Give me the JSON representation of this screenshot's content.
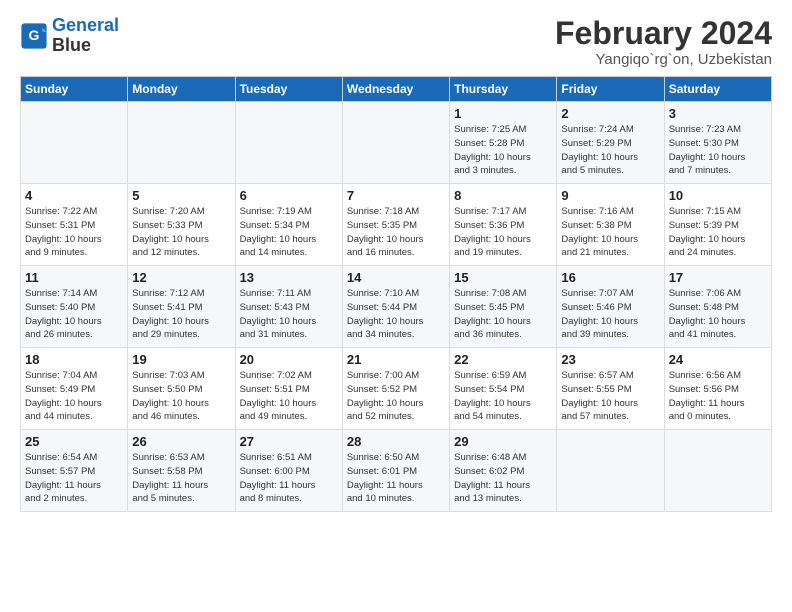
{
  "logo": {
    "line1": "General",
    "line2": "Blue"
  },
  "title": "February 2024",
  "location": "Yangiqo`rg`on, Uzbekistan",
  "days_of_week": [
    "Sunday",
    "Monday",
    "Tuesday",
    "Wednesday",
    "Thursday",
    "Friday",
    "Saturday"
  ],
  "weeks": [
    [
      {
        "day": "",
        "info": ""
      },
      {
        "day": "",
        "info": ""
      },
      {
        "day": "",
        "info": ""
      },
      {
        "day": "",
        "info": ""
      },
      {
        "day": "1",
        "info": "Sunrise: 7:25 AM\nSunset: 5:28 PM\nDaylight: 10 hours\nand 3 minutes."
      },
      {
        "day": "2",
        "info": "Sunrise: 7:24 AM\nSunset: 5:29 PM\nDaylight: 10 hours\nand 5 minutes."
      },
      {
        "day": "3",
        "info": "Sunrise: 7:23 AM\nSunset: 5:30 PM\nDaylight: 10 hours\nand 7 minutes."
      }
    ],
    [
      {
        "day": "4",
        "info": "Sunrise: 7:22 AM\nSunset: 5:31 PM\nDaylight: 10 hours\nand 9 minutes."
      },
      {
        "day": "5",
        "info": "Sunrise: 7:20 AM\nSunset: 5:33 PM\nDaylight: 10 hours\nand 12 minutes."
      },
      {
        "day": "6",
        "info": "Sunrise: 7:19 AM\nSunset: 5:34 PM\nDaylight: 10 hours\nand 14 minutes."
      },
      {
        "day": "7",
        "info": "Sunrise: 7:18 AM\nSunset: 5:35 PM\nDaylight: 10 hours\nand 16 minutes."
      },
      {
        "day": "8",
        "info": "Sunrise: 7:17 AM\nSunset: 5:36 PM\nDaylight: 10 hours\nand 19 minutes."
      },
      {
        "day": "9",
        "info": "Sunrise: 7:16 AM\nSunset: 5:38 PM\nDaylight: 10 hours\nand 21 minutes."
      },
      {
        "day": "10",
        "info": "Sunrise: 7:15 AM\nSunset: 5:39 PM\nDaylight: 10 hours\nand 24 minutes."
      }
    ],
    [
      {
        "day": "11",
        "info": "Sunrise: 7:14 AM\nSunset: 5:40 PM\nDaylight: 10 hours\nand 26 minutes."
      },
      {
        "day": "12",
        "info": "Sunrise: 7:12 AM\nSunset: 5:41 PM\nDaylight: 10 hours\nand 29 minutes."
      },
      {
        "day": "13",
        "info": "Sunrise: 7:11 AM\nSunset: 5:43 PM\nDaylight: 10 hours\nand 31 minutes."
      },
      {
        "day": "14",
        "info": "Sunrise: 7:10 AM\nSunset: 5:44 PM\nDaylight: 10 hours\nand 34 minutes."
      },
      {
        "day": "15",
        "info": "Sunrise: 7:08 AM\nSunset: 5:45 PM\nDaylight: 10 hours\nand 36 minutes."
      },
      {
        "day": "16",
        "info": "Sunrise: 7:07 AM\nSunset: 5:46 PM\nDaylight: 10 hours\nand 39 minutes."
      },
      {
        "day": "17",
        "info": "Sunrise: 7:06 AM\nSunset: 5:48 PM\nDaylight: 10 hours\nand 41 minutes."
      }
    ],
    [
      {
        "day": "18",
        "info": "Sunrise: 7:04 AM\nSunset: 5:49 PM\nDaylight: 10 hours\nand 44 minutes."
      },
      {
        "day": "19",
        "info": "Sunrise: 7:03 AM\nSunset: 5:50 PM\nDaylight: 10 hours\nand 46 minutes."
      },
      {
        "day": "20",
        "info": "Sunrise: 7:02 AM\nSunset: 5:51 PM\nDaylight: 10 hours\nand 49 minutes."
      },
      {
        "day": "21",
        "info": "Sunrise: 7:00 AM\nSunset: 5:52 PM\nDaylight: 10 hours\nand 52 minutes."
      },
      {
        "day": "22",
        "info": "Sunrise: 6:59 AM\nSunset: 5:54 PM\nDaylight: 10 hours\nand 54 minutes."
      },
      {
        "day": "23",
        "info": "Sunrise: 6:57 AM\nSunset: 5:55 PM\nDaylight: 10 hours\nand 57 minutes."
      },
      {
        "day": "24",
        "info": "Sunrise: 6:56 AM\nSunset: 5:56 PM\nDaylight: 11 hours\nand 0 minutes."
      }
    ],
    [
      {
        "day": "25",
        "info": "Sunrise: 6:54 AM\nSunset: 5:57 PM\nDaylight: 11 hours\nand 2 minutes."
      },
      {
        "day": "26",
        "info": "Sunrise: 6:53 AM\nSunset: 5:58 PM\nDaylight: 11 hours\nand 5 minutes."
      },
      {
        "day": "27",
        "info": "Sunrise: 6:51 AM\nSunset: 6:00 PM\nDaylight: 11 hours\nand 8 minutes."
      },
      {
        "day": "28",
        "info": "Sunrise: 6:50 AM\nSunset: 6:01 PM\nDaylight: 11 hours\nand 10 minutes."
      },
      {
        "day": "29",
        "info": "Sunrise: 6:48 AM\nSunset: 6:02 PM\nDaylight: 11 hours\nand 13 minutes."
      },
      {
        "day": "",
        "info": ""
      },
      {
        "day": "",
        "info": ""
      }
    ]
  ]
}
